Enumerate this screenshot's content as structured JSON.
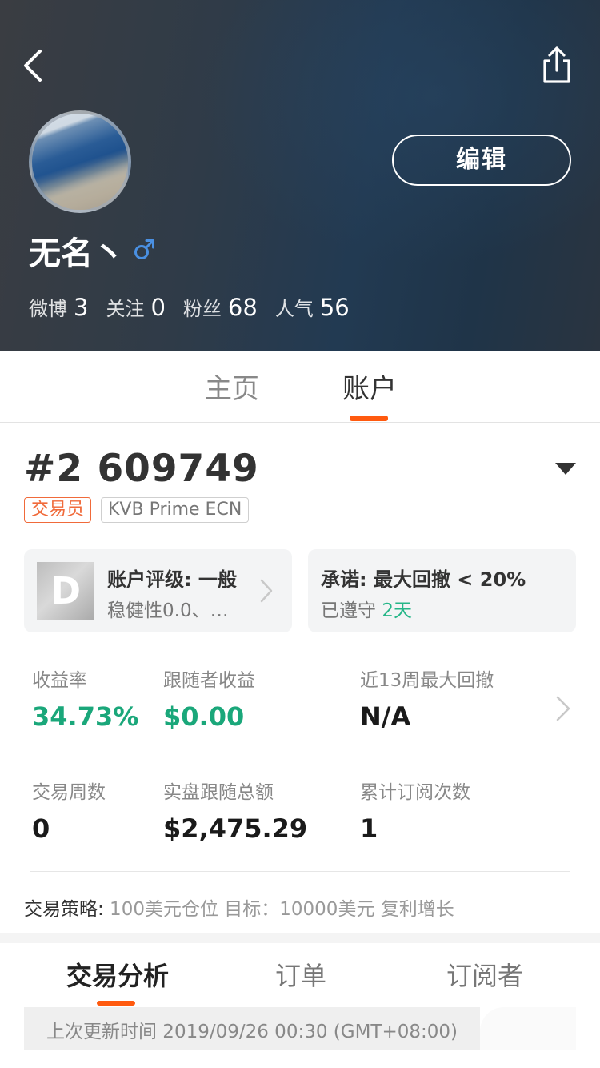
{
  "header": {
    "back_icon": "chevron-left-icon",
    "share_icon": "share-icon",
    "edit_label": "编辑",
    "username": "无名丶",
    "gender_symbol": "♂",
    "gender_color": "#4a90e2",
    "stats": [
      {
        "label": "微博",
        "value": "3"
      },
      {
        "label": "关注",
        "value": "0"
      },
      {
        "label": "粉丝",
        "value": "68"
      },
      {
        "label": "人气",
        "value": "56"
      }
    ]
  },
  "main_tabs": [
    {
      "label": "主页",
      "active": false
    },
    {
      "label": "账户",
      "active": true
    }
  ],
  "account": {
    "number": "#2 609749",
    "role_tag": "交易员",
    "platform_tag": "KVB Prime ECN",
    "rating_card": {
      "grade": "D",
      "title": "账户评级: 一般",
      "subtitle": "稳健性0.0、…"
    },
    "promise_card": {
      "title": "承诺: 最大回撤 < 20%",
      "subtitle_prefix": "已遵守",
      "subtitle_days": "2天"
    },
    "metrics": [
      {
        "label": "收益率",
        "value": "34.73%",
        "highlight": true
      },
      {
        "label": "跟随者收益",
        "value": "$0.00",
        "highlight": true
      },
      {
        "label": "近13周最大回撤",
        "value": "N/A",
        "highlight": false
      },
      {
        "label": "交易周数",
        "value": "0",
        "highlight": false
      },
      {
        "label": "实盘跟随总额",
        "value": "$2,475.29",
        "highlight": false
      },
      {
        "label": "累计订阅次数",
        "value": "1",
        "highlight": false
      }
    ],
    "strategy_label": "交易策略:",
    "strategy_value": " 100美元仓位 目标：10000美元 复利增长"
  },
  "sub_tabs": [
    {
      "label": "交易分析",
      "active": true
    },
    {
      "label": "订单",
      "active": false
    },
    {
      "label": "订阅者",
      "active": false
    }
  ],
  "update_text": "上次更新时间 2019/09/26 00:30 (GMT+08:00)",
  "colors": {
    "accent": "#ff5a0f",
    "positive": "#1aa77a",
    "tag_orange": "#f06a3a"
  }
}
